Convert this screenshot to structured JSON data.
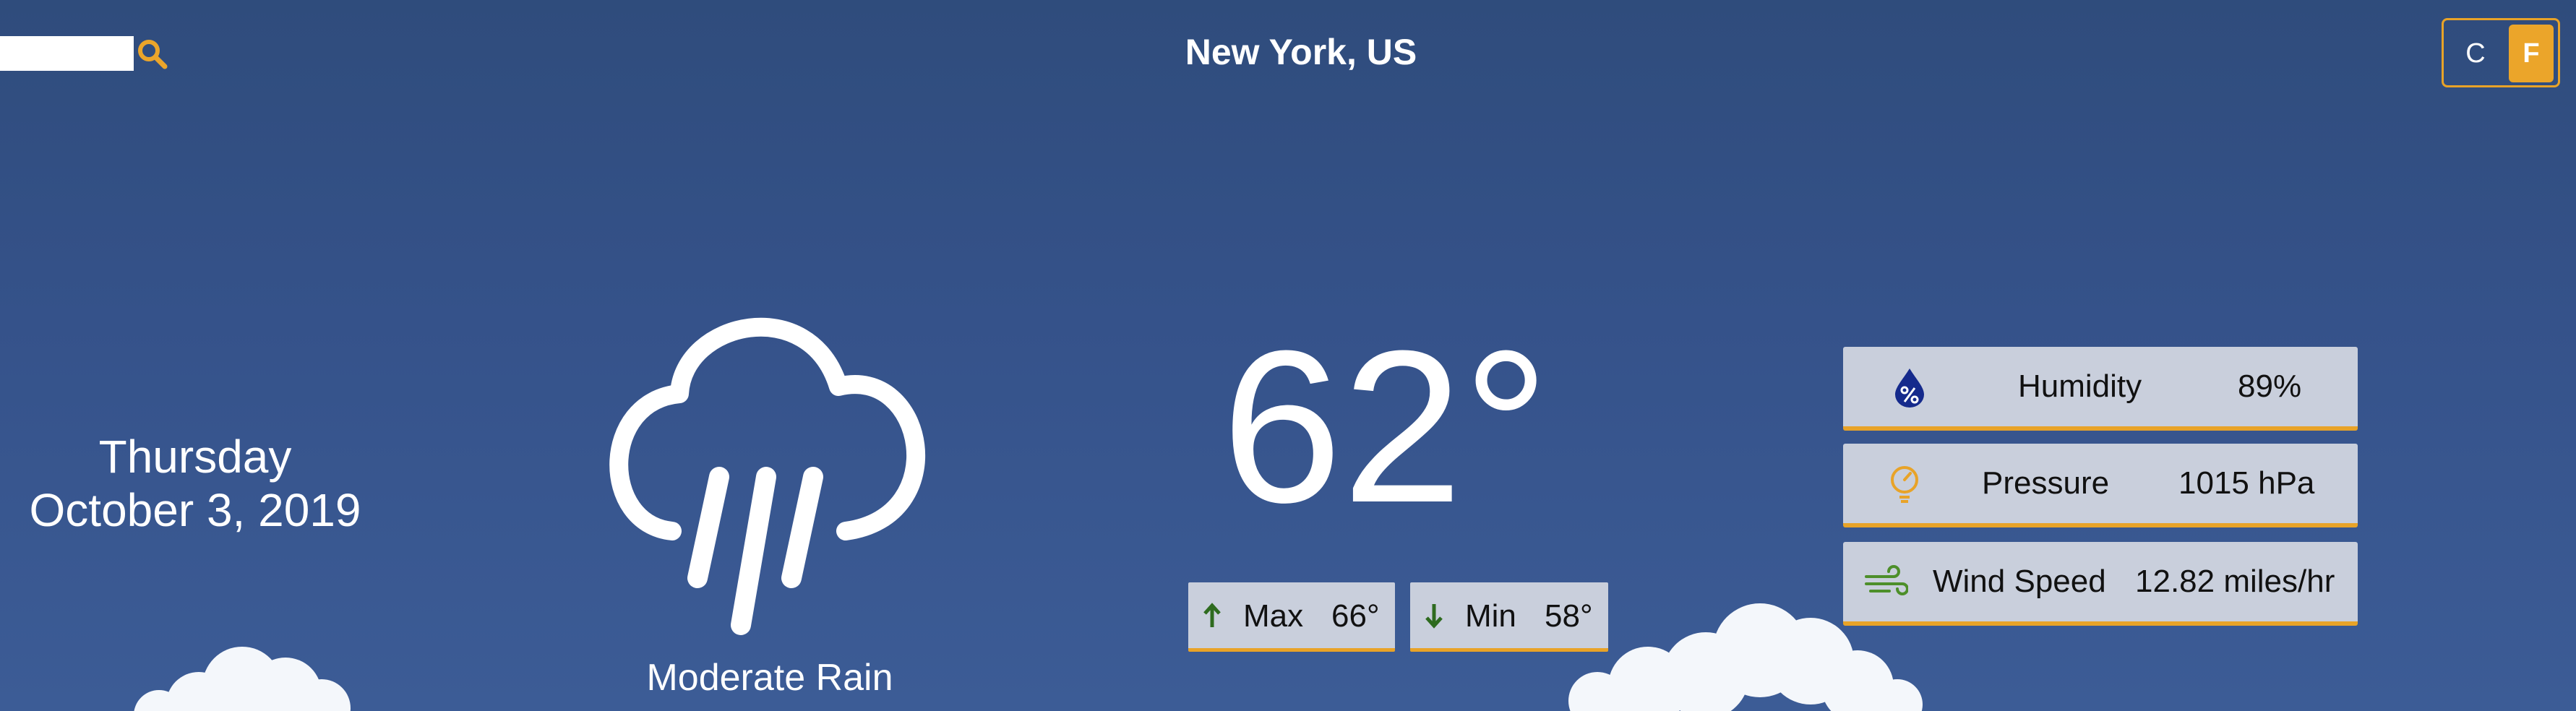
{
  "search": {
    "value": "",
    "icon": "search-icon",
    "accent": "#eba52a"
  },
  "location": "New York, US",
  "units": {
    "celsius_label": "C",
    "fahrenheit_label": "F",
    "selected": "F"
  },
  "date": {
    "weekday": "Thursday",
    "full": "October 3, 2019"
  },
  "condition": {
    "icon": "rain-cloud-icon",
    "label": "Moderate Rain"
  },
  "temperature": {
    "current": "62°",
    "max_label": "Max",
    "max_value": "66°",
    "min_label": "Min",
    "min_value": "58°"
  },
  "stats": {
    "humidity": {
      "icon": "humidity-drop-icon",
      "label": "Humidity",
      "value": "89%"
    },
    "pressure": {
      "icon": "pressure-gauge-icon",
      "label": "Pressure",
      "value": "1015 hPa"
    },
    "wind": {
      "icon": "wind-icon",
      "label": "Wind Speed",
      "value": "12.82 miles/hr"
    }
  },
  "colors": {
    "background": "#34518a",
    "accent": "#eba52a",
    "panel": "#c9cfdc",
    "arrow_green": "#2e6b1f",
    "humidity_blue": "#152a8c"
  }
}
